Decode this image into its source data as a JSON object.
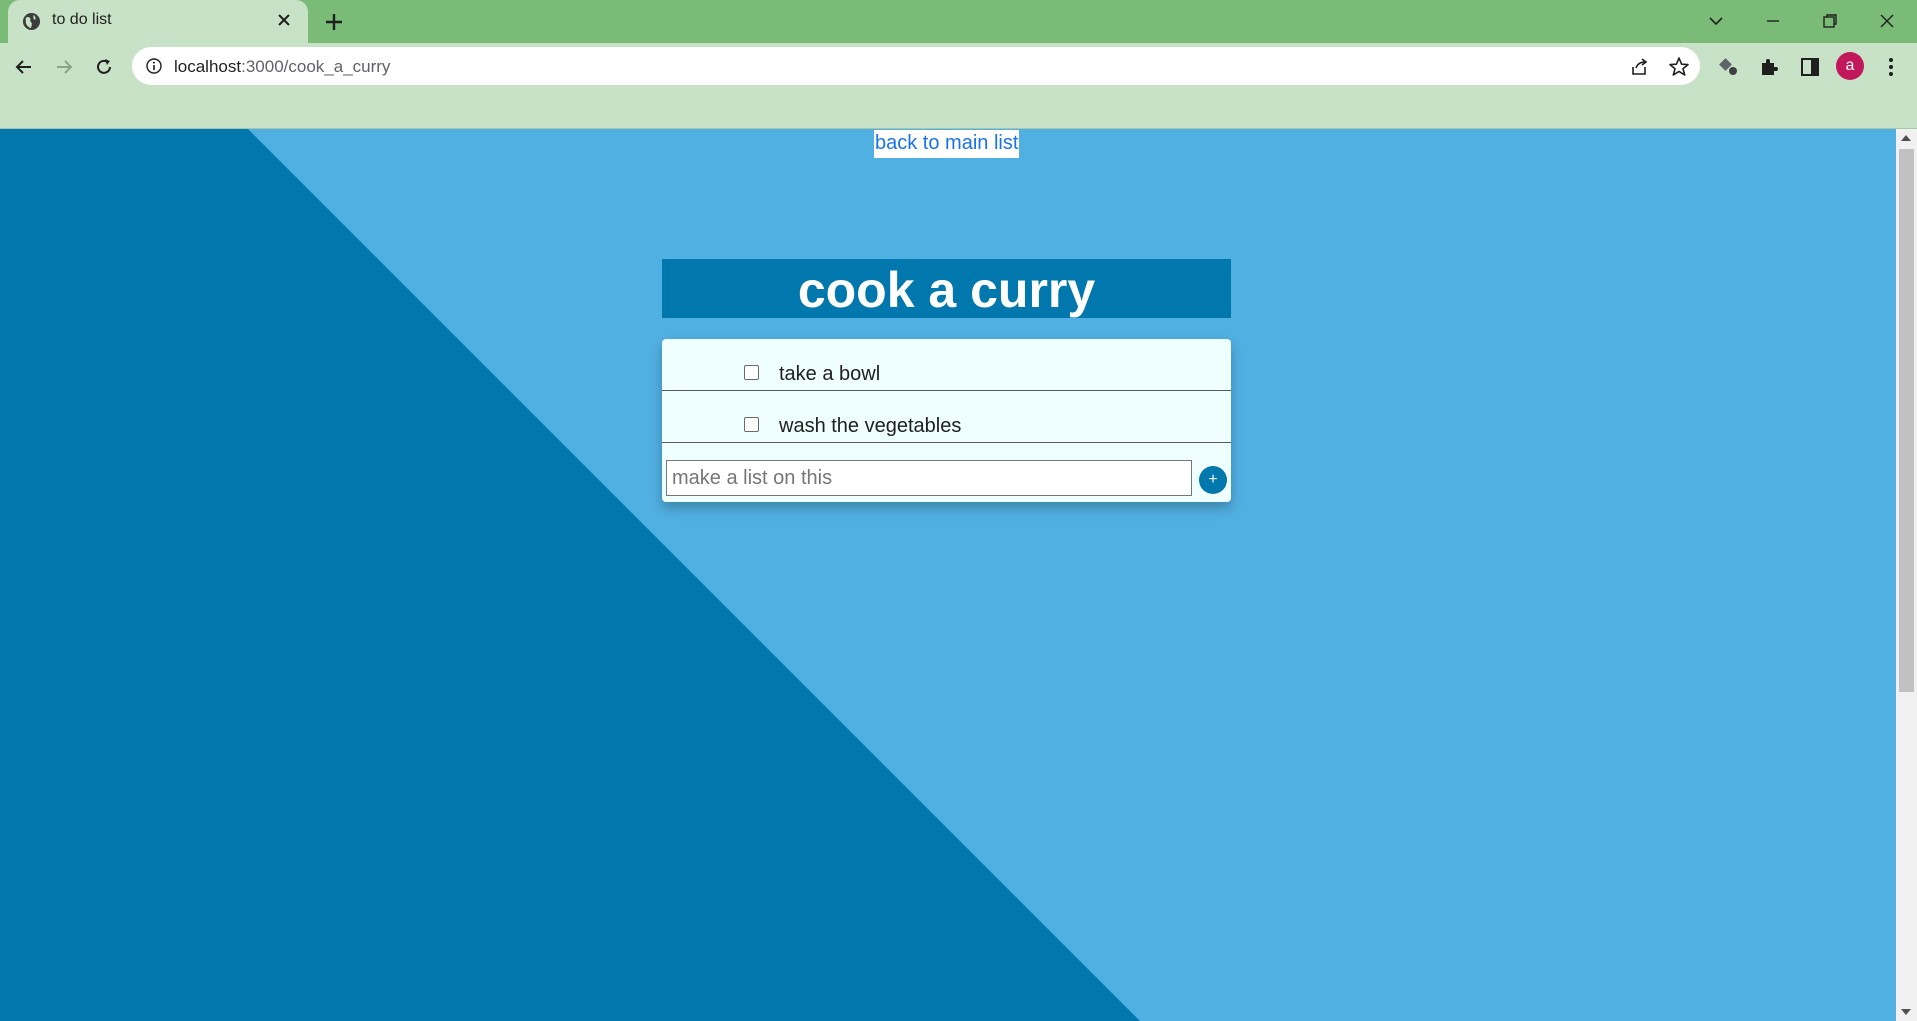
{
  "browser": {
    "tab_title": "to do list",
    "url_host": "localhost",
    "url_path": ":3000/cook_a_curry",
    "profile_initial": "a"
  },
  "page": {
    "back_link": "back to main list",
    "list_title": "cook a curry",
    "items": [
      {
        "label": "take a bowl",
        "checked": false
      },
      {
        "label": "wash the vegetables",
        "checked": false
      }
    ],
    "new_item_placeholder": "make a list on this",
    "add_button": "+"
  },
  "colors": {
    "chrome_frame": "#7bbb78",
    "chrome_toolbar": "#c7e2c6",
    "page_background": "#51b0e2",
    "dark_triangle": "#0077ad",
    "card_background": "#effeff"
  }
}
